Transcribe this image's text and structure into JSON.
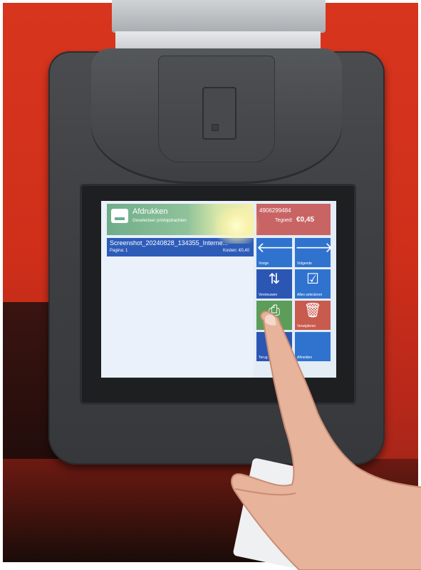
{
  "screen": {
    "header": {
      "title": "Afdrukken",
      "subtitle": "Geselecteer printopdrachten"
    },
    "print_job": {
      "name": "Screenshot_20240828_134355_Interne...",
      "pages": "Pagina: 1",
      "cost": "Kosten: €0,40"
    },
    "balance": {
      "card_id": "4906299484",
      "label": "Tegoed:",
      "amount": "€0,45"
    },
    "tiles": [
      {
        "label": "Vorige",
        "icon": "arrow-left-icon",
        "glyph": "🡐"
      },
      {
        "label": "Volgende",
        "icon": "arrow-right-icon",
        "glyph": "🡒"
      },
      {
        "label": "Vernieuwen",
        "icon": "refresh-icon",
        "glyph": "⇅"
      },
      {
        "label": "Alles selecteren",
        "icon": "select-all-icon",
        "glyph": "☑"
      },
      {
        "label": "",
        "icon": "print-icon",
        "glyph": "⎙"
      },
      {
        "label": "Verwijderen",
        "icon": "trash-icon",
        "glyph": "🗑"
      },
      {
        "label": "Terug",
        "icon": "back-icon",
        "glyph": ""
      },
      {
        "label": "Afmelden",
        "icon": "logout-icon",
        "glyph": ""
      }
    ],
    "colors": {
      "header_tile": "#6fae8a",
      "job_row": "#2d5cb8",
      "balance_tile": "#c96464",
      "tile_blue": "#2f73cf",
      "tile_green": "#5b9d59",
      "tile_red": "#c85b4e"
    }
  }
}
